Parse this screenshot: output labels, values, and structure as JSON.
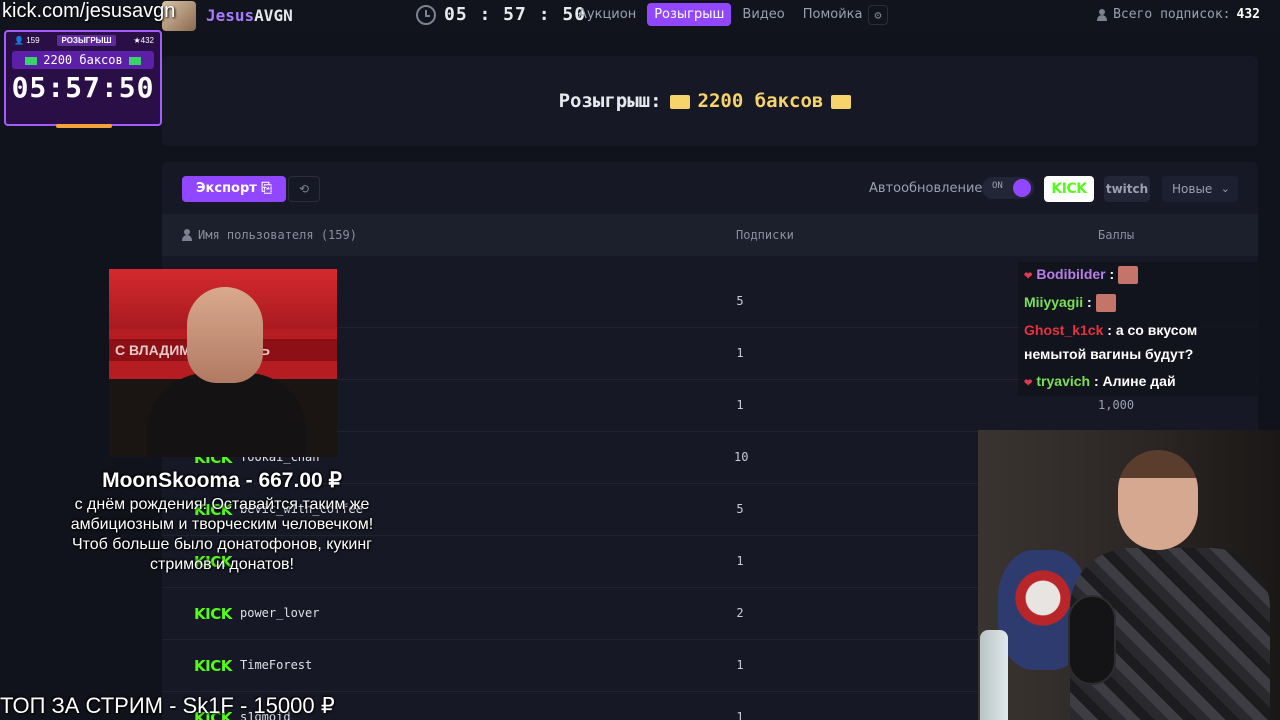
{
  "header": {
    "brand_prefix": "Jesus",
    "brand_suffix": "AVGN",
    "timer": "05 : 57 : 50",
    "tabs": [
      {
        "label": "Аукцион",
        "active": false
      },
      {
        "label": "Розыгрыш",
        "active": true
      },
      {
        "label": "Видео",
        "active": false
      },
      {
        "label": "Помойка",
        "active": false
      }
    ],
    "subs_label": "Всего подписок:",
    "subs_total": "432"
  },
  "overlay": {
    "kick_url": "kick.com/jesusavgn",
    "widget": {
      "count_left": "159",
      "label": "РОЗЫГРЫШ",
      "count_right": "432",
      "prize": "2200 баксов",
      "timer": "05:57:50"
    },
    "donation": {
      "header": "MoonSkooma - 667.00 ₽",
      "message": "с днём рождения! Оставайтся таким же амбициозным и творческим человечком! Чтоб больше было донатофонов, кукинг стримов и донатов!"
    },
    "video_strip": "С ВЛАДИМ    А СОЛОВЬ",
    "top_donor": "ТОП ЗА СТРИМ - Sk1F - 15000 ₽",
    "chat": [
      {
        "user": "Bodibilder",
        "color": "#b87ee8",
        "text": "",
        "heart": true,
        "emote": true
      },
      {
        "user": "Miiyyagii",
        "color": "#7be055",
        "text": "",
        "heart": false,
        "emote": true
      },
      {
        "user": "Ghost_k1ck",
        "color": "#e8323f",
        "text": "а со вкусом",
        "heart": false,
        "emote": false
      },
      {
        "user": "",
        "color": "#ffffff",
        "text": "немытой вагины будут?",
        "heart": false,
        "emote": false
      },
      {
        "user": "tryavich",
        "color": "#7be055",
        "text": "Алине дай",
        "heart": true,
        "emote": false
      }
    ]
  },
  "giveaway": {
    "title_label": "Розыгрыш:",
    "prize": "2200 баксов"
  },
  "toolbar": {
    "export_label": "Экспорт",
    "auto_update_label": "Автообновление",
    "toggle_state": "ON",
    "kick_label": "KICK",
    "twitch_label": "twitch",
    "sort_label": "Новые"
  },
  "table": {
    "headers": {
      "user": "Имя пользователя (159)",
      "subs": "Подписки",
      "points": "Баллы"
    },
    "rows": [
      {
        "user": "",
        "subs": "5",
        "points": ""
      },
      {
        "user": "",
        "subs": "1",
        "points": ""
      },
      {
        "user": "",
        "subs": "1",
        "points": "1,000"
      },
      {
        "user": "Yookai_chan",
        "subs": "10",
        "points": ""
      },
      {
        "user": "bevic_with_coffee",
        "subs": "5",
        "points": ""
      },
      {
        "user": "",
        "subs": "1",
        "points": ""
      },
      {
        "user": "power_lover",
        "subs": "2",
        "points": ""
      },
      {
        "user": "TimeForest",
        "subs": "1",
        "points": ""
      },
      {
        "user": "s1gmoid",
        "subs": "1",
        "points": ""
      }
    ]
  }
}
